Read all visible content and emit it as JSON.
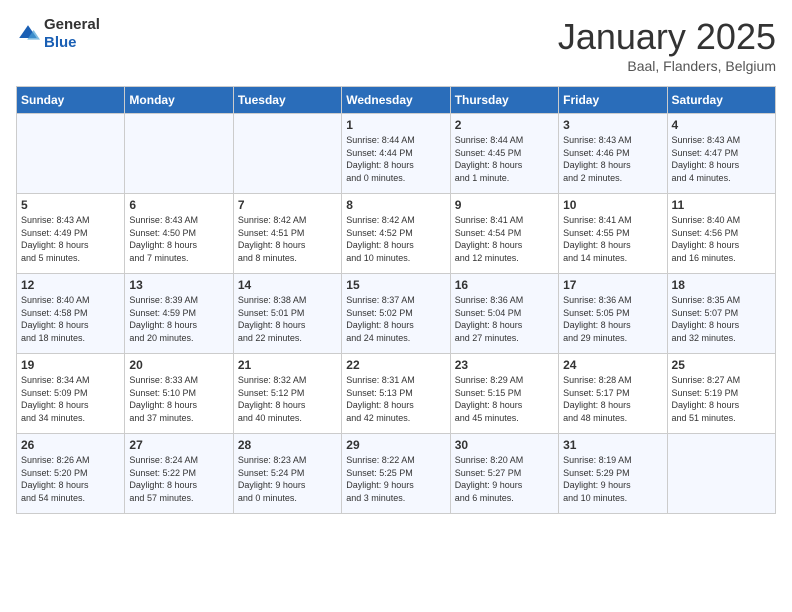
{
  "header": {
    "logo": {
      "general": "General",
      "blue": "Blue"
    },
    "title": "January 2025",
    "location": "Baal, Flanders, Belgium"
  },
  "days_of_week": [
    "Sunday",
    "Monday",
    "Tuesday",
    "Wednesday",
    "Thursday",
    "Friday",
    "Saturday"
  ],
  "weeks": [
    [
      {
        "day": "",
        "content": ""
      },
      {
        "day": "",
        "content": ""
      },
      {
        "day": "",
        "content": ""
      },
      {
        "day": "1",
        "content": "Sunrise: 8:44 AM\nSunset: 4:44 PM\nDaylight: 8 hours\nand 0 minutes."
      },
      {
        "day": "2",
        "content": "Sunrise: 8:44 AM\nSunset: 4:45 PM\nDaylight: 8 hours\nand 1 minute."
      },
      {
        "day": "3",
        "content": "Sunrise: 8:43 AM\nSunset: 4:46 PM\nDaylight: 8 hours\nand 2 minutes."
      },
      {
        "day": "4",
        "content": "Sunrise: 8:43 AM\nSunset: 4:47 PM\nDaylight: 8 hours\nand 4 minutes."
      }
    ],
    [
      {
        "day": "5",
        "content": "Sunrise: 8:43 AM\nSunset: 4:49 PM\nDaylight: 8 hours\nand 5 minutes."
      },
      {
        "day": "6",
        "content": "Sunrise: 8:43 AM\nSunset: 4:50 PM\nDaylight: 8 hours\nand 7 minutes."
      },
      {
        "day": "7",
        "content": "Sunrise: 8:42 AM\nSunset: 4:51 PM\nDaylight: 8 hours\nand 8 minutes."
      },
      {
        "day": "8",
        "content": "Sunrise: 8:42 AM\nSunset: 4:52 PM\nDaylight: 8 hours\nand 10 minutes."
      },
      {
        "day": "9",
        "content": "Sunrise: 8:41 AM\nSunset: 4:54 PM\nDaylight: 8 hours\nand 12 minutes."
      },
      {
        "day": "10",
        "content": "Sunrise: 8:41 AM\nSunset: 4:55 PM\nDaylight: 8 hours\nand 14 minutes."
      },
      {
        "day": "11",
        "content": "Sunrise: 8:40 AM\nSunset: 4:56 PM\nDaylight: 8 hours\nand 16 minutes."
      }
    ],
    [
      {
        "day": "12",
        "content": "Sunrise: 8:40 AM\nSunset: 4:58 PM\nDaylight: 8 hours\nand 18 minutes."
      },
      {
        "day": "13",
        "content": "Sunrise: 8:39 AM\nSunset: 4:59 PM\nDaylight: 8 hours\nand 20 minutes."
      },
      {
        "day": "14",
        "content": "Sunrise: 8:38 AM\nSunset: 5:01 PM\nDaylight: 8 hours\nand 22 minutes."
      },
      {
        "day": "15",
        "content": "Sunrise: 8:37 AM\nSunset: 5:02 PM\nDaylight: 8 hours\nand 24 minutes."
      },
      {
        "day": "16",
        "content": "Sunrise: 8:36 AM\nSunset: 5:04 PM\nDaylight: 8 hours\nand 27 minutes."
      },
      {
        "day": "17",
        "content": "Sunrise: 8:36 AM\nSunset: 5:05 PM\nDaylight: 8 hours\nand 29 minutes."
      },
      {
        "day": "18",
        "content": "Sunrise: 8:35 AM\nSunset: 5:07 PM\nDaylight: 8 hours\nand 32 minutes."
      }
    ],
    [
      {
        "day": "19",
        "content": "Sunrise: 8:34 AM\nSunset: 5:09 PM\nDaylight: 8 hours\nand 34 minutes."
      },
      {
        "day": "20",
        "content": "Sunrise: 8:33 AM\nSunset: 5:10 PM\nDaylight: 8 hours\nand 37 minutes."
      },
      {
        "day": "21",
        "content": "Sunrise: 8:32 AM\nSunset: 5:12 PM\nDaylight: 8 hours\nand 40 minutes."
      },
      {
        "day": "22",
        "content": "Sunrise: 8:31 AM\nSunset: 5:13 PM\nDaylight: 8 hours\nand 42 minutes."
      },
      {
        "day": "23",
        "content": "Sunrise: 8:29 AM\nSunset: 5:15 PM\nDaylight: 8 hours\nand 45 minutes."
      },
      {
        "day": "24",
        "content": "Sunrise: 8:28 AM\nSunset: 5:17 PM\nDaylight: 8 hours\nand 48 minutes."
      },
      {
        "day": "25",
        "content": "Sunrise: 8:27 AM\nSunset: 5:19 PM\nDaylight: 8 hours\nand 51 minutes."
      }
    ],
    [
      {
        "day": "26",
        "content": "Sunrise: 8:26 AM\nSunset: 5:20 PM\nDaylight: 8 hours\nand 54 minutes."
      },
      {
        "day": "27",
        "content": "Sunrise: 8:24 AM\nSunset: 5:22 PM\nDaylight: 8 hours\nand 57 minutes."
      },
      {
        "day": "28",
        "content": "Sunrise: 8:23 AM\nSunset: 5:24 PM\nDaylight: 9 hours\nand 0 minutes."
      },
      {
        "day": "29",
        "content": "Sunrise: 8:22 AM\nSunset: 5:25 PM\nDaylight: 9 hours\nand 3 minutes."
      },
      {
        "day": "30",
        "content": "Sunrise: 8:20 AM\nSunset: 5:27 PM\nDaylight: 9 hours\nand 6 minutes."
      },
      {
        "day": "31",
        "content": "Sunrise: 8:19 AM\nSunset: 5:29 PM\nDaylight: 9 hours\nand 10 minutes."
      },
      {
        "day": "",
        "content": ""
      }
    ]
  ]
}
